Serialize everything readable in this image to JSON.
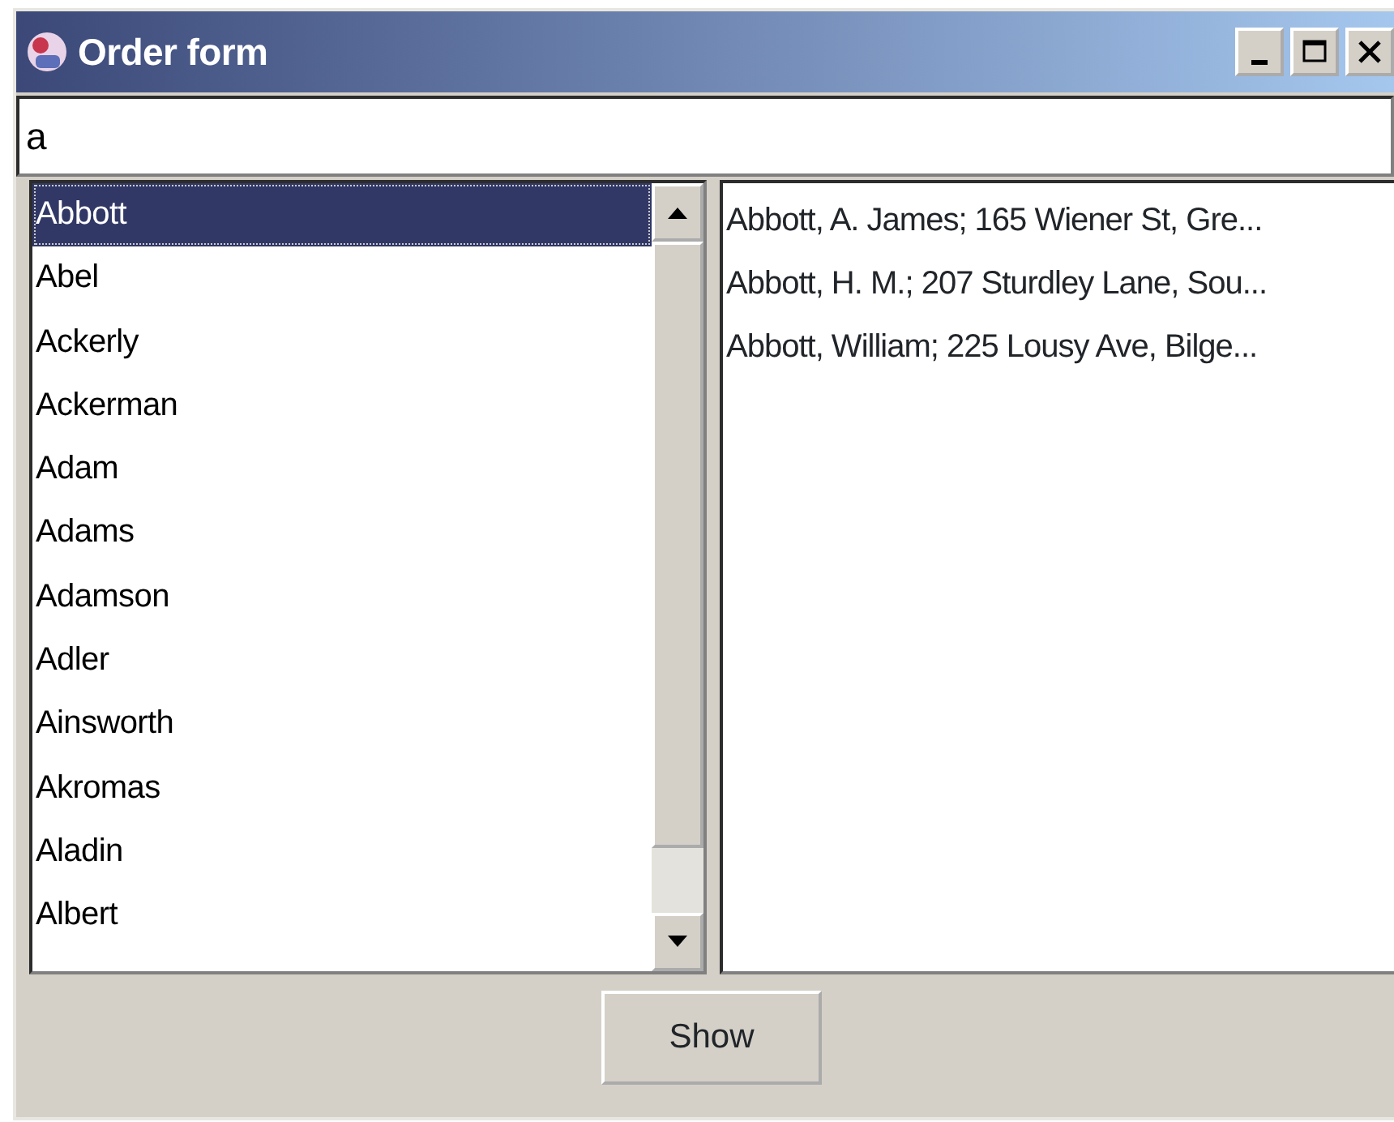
{
  "window": {
    "title": "Order form"
  },
  "search": {
    "value": "a"
  },
  "names": [
    {
      "label": "Abbott",
      "selected": true
    },
    {
      "label": "Abel",
      "selected": false
    },
    {
      "label": "Ackerly",
      "selected": false
    },
    {
      "label": "Ackerman",
      "selected": false
    },
    {
      "label": "Adam",
      "selected": false
    },
    {
      "label": "Adams",
      "selected": false
    },
    {
      "label": "Adamson",
      "selected": false
    },
    {
      "label": "Adler",
      "selected": false
    },
    {
      "label": "Ainsworth",
      "selected": false
    },
    {
      "label": "Akromas",
      "selected": false
    },
    {
      "label": "Aladin",
      "selected": false
    },
    {
      "label": "Albert",
      "selected": false
    }
  ],
  "results": [
    "Abbott, A. James; 165 Wiener St, Gre...",
    "Abbott, H. M.; 207 Sturdley Lane, Sou...",
    "Abbott, William; 225 Lousy Ave, Bilge..."
  ],
  "buttons": [
    "Show"
  ]
}
